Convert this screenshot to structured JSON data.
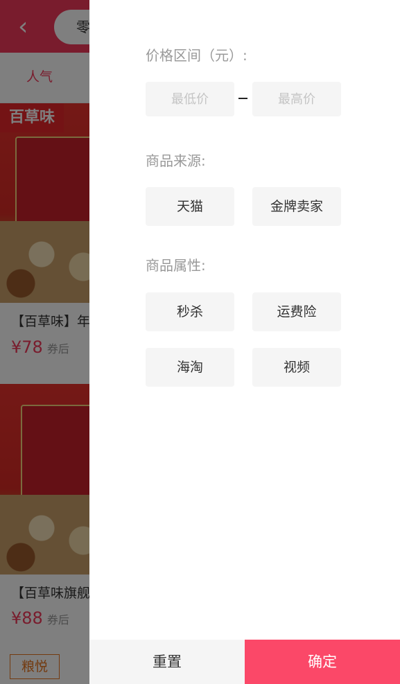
{
  "background": {
    "search_text": "零",
    "tab_label": "人气",
    "products": [
      {
        "brand": "百草味",
        "title": "【百草味】年货",
        "price": "¥78",
        "coupon": "券后"
      },
      {
        "brand": "百草味",
        "title": "【百草味旗舰店",
        "price": "¥88",
        "coupon": "券后"
      }
    ],
    "third_brand": "粮悦"
  },
  "filter": {
    "price_range": {
      "title": "价格区间（元）:",
      "min_placeholder": "最低价",
      "max_placeholder": "最高价",
      "min_value": "",
      "max_value": ""
    },
    "source": {
      "title": "商品来源:",
      "options": [
        "天猫",
        "金牌卖家"
      ]
    },
    "attributes": {
      "title": "商品属性:",
      "options": [
        "秒杀",
        "运费险",
        "海淘",
        "视频"
      ]
    },
    "reset_label": "重置",
    "confirm_label": "确定"
  },
  "colors": {
    "accent": "#f2385a",
    "confirm_button": "#fb4868",
    "chip_background": "#f5f5f5",
    "section_title": "#999999"
  }
}
